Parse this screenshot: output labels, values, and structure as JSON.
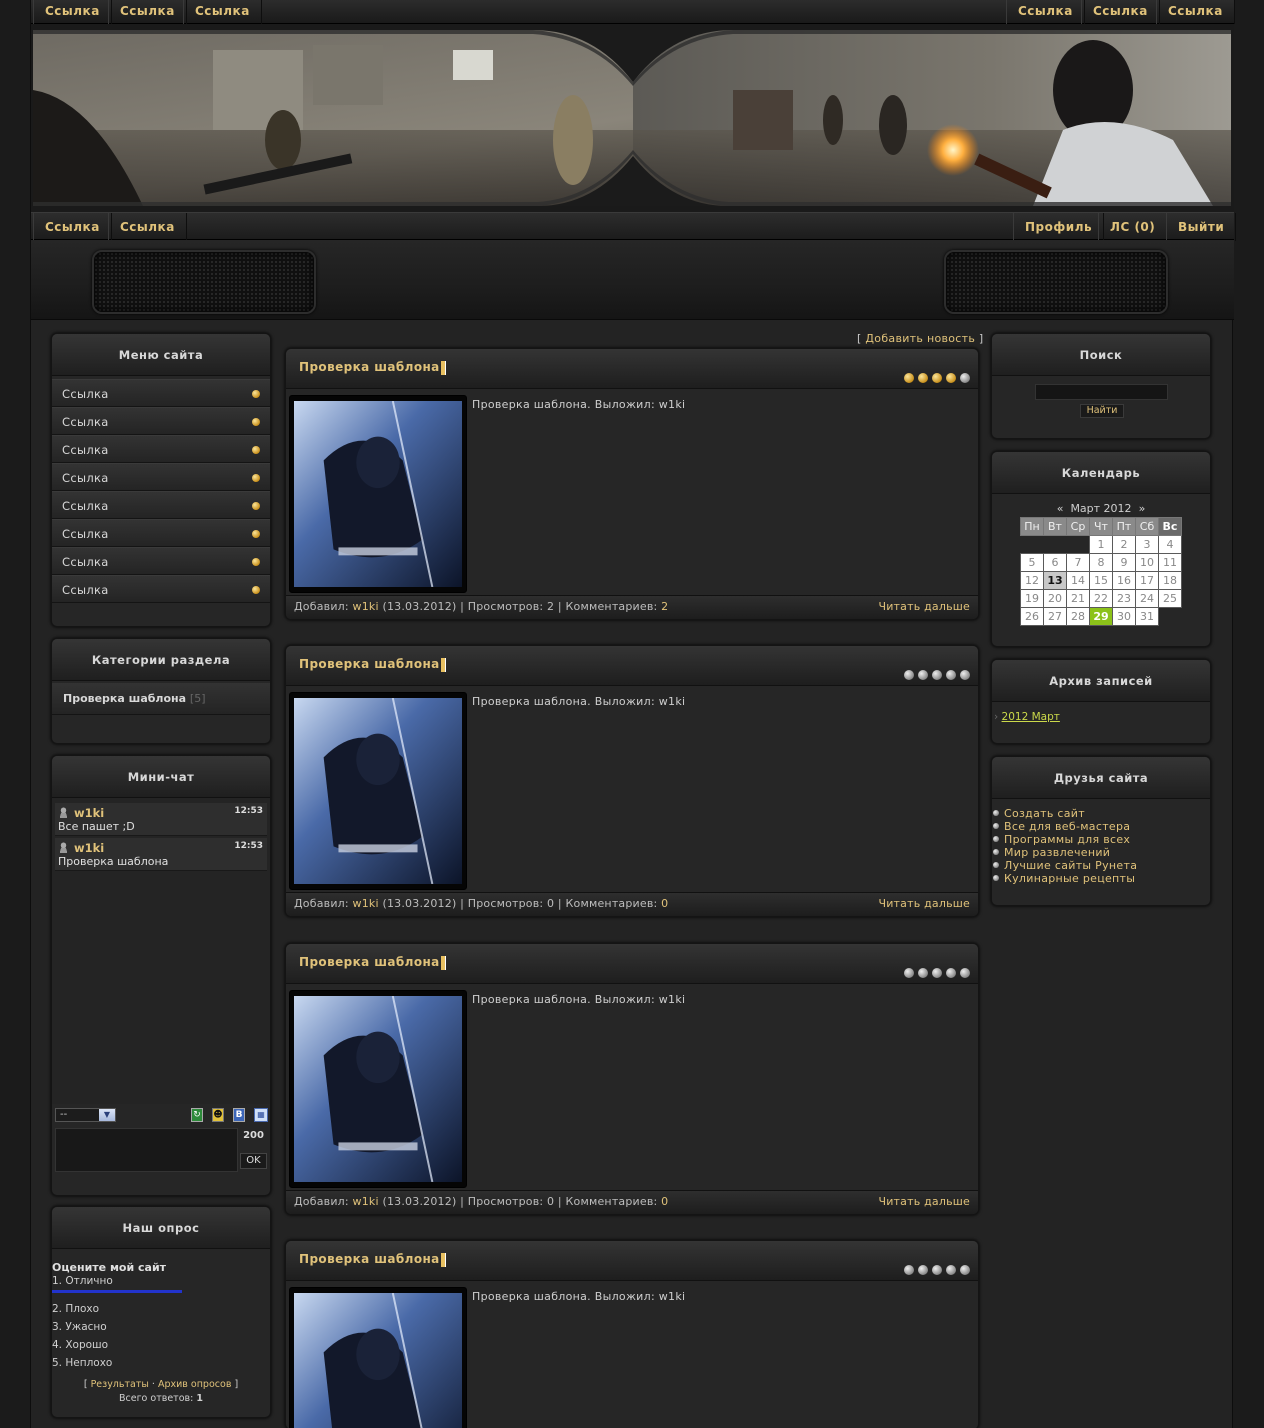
{
  "top_nav": {
    "left": [
      "Ссылка",
      "Ссылка",
      "Ссылка"
    ],
    "right": [
      "Ссылка",
      "Ссылка",
      "Ссылка"
    ]
  },
  "sub_nav": {
    "left": [
      "Ссылка",
      "Ссылка"
    ],
    "right": [
      "Профиль",
      "ЛС (0)",
      "Выйти"
    ]
  },
  "site_menu": {
    "title": "Меню сайта",
    "items": [
      "Ссылка",
      "Ссылка",
      "Ссылка",
      "Ссылка",
      "Ссылка",
      "Ссылка",
      "Ссылка",
      "Ссылка"
    ]
  },
  "categories": {
    "title": "Категории раздела",
    "items": [
      {
        "label": "Проверка шаблона",
        "count": "[5]"
      }
    ]
  },
  "mini_chat": {
    "title": "Мини-чат",
    "messages": [
      {
        "user": "w1ki",
        "time": "12:53",
        "text": "Все пашет ;D"
      },
      {
        "user": "w1ki",
        "time": "12:53",
        "text": "Проверка шаблона"
      }
    ],
    "select_value": "--",
    "counter": "200",
    "ok_label": "OK"
  },
  "poll": {
    "title": "Наш опрос",
    "question": "Оцените мой сайт",
    "options": [
      "1. Отлично",
      "2. Плохо",
      "3. Ужасно",
      "4. Хорошо",
      "5. Неплохо"
    ],
    "results_label": "Результаты",
    "sep": "·",
    "archive_label": "Архив опросов",
    "total_label": "Всего ответов:",
    "total_value": "1"
  },
  "add_news": "Добавить новость",
  "posts": [
    {
      "title": "Проверка шаблона",
      "text": "Проверка шаблона. Выложил: w1ki",
      "author": "w1ki",
      "date": "(13.03.2012)",
      "views": "2",
      "comments": "2",
      "rating": 4
    },
    {
      "title": "Проверка шаблона",
      "text": "Проверка шаблона. Выложил: w1ki",
      "author": "w1ki",
      "date": "(13.03.2012)",
      "views": "0",
      "comments": "0",
      "rating": 0
    },
    {
      "title": "Проверка шаблона",
      "text": "Проверка шаблона. Выложил: w1ki",
      "author": "w1ki",
      "date": "(13.03.2012)",
      "views": "0",
      "comments": "0",
      "rating": 0
    },
    {
      "title": "Проверка шаблона",
      "text": "Проверка шаблона. Выложил: w1ki",
      "author": "",
      "date": "",
      "views": "",
      "comments": "",
      "rating": 0
    }
  ],
  "post_labels": {
    "added": "Добавил:",
    "views": "| Просмотров:",
    "comments": "| Комментариев:",
    "read_more": "Читать дальше"
  },
  "search": {
    "title": "Поиск",
    "button": "Найти"
  },
  "calendar": {
    "title": "Календарь",
    "month": "Март 2012",
    "prev": "«",
    "next": "»",
    "weekdays": [
      "Пн",
      "Вт",
      "Ср",
      "Чт",
      "Пт",
      "Сб",
      "Вс"
    ],
    "weeks": [
      [
        "",
        "",
        "",
        "1",
        "2",
        "3",
        "4"
      ],
      [
        "5",
        "6",
        "7",
        "8",
        "9",
        "10",
        "11"
      ],
      [
        "12",
        "13",
        "14",
        "15",
        "16",
        "17",
        "18"
      ],
      [
        "19",
        "20",
        "21",
        "22",
        "23",
        "24",
        "25"
      ],
      [
        "26",
        "27",
        "28",
        "29",
        "30",
        "31",
        ""
      ]
    ],
    "bold_day": "13",
    "highlight_day": "29"
  },
  "archive": {
    "title": "Архив записей",
    "items": [
      "2012 Март"
    ]
  },
  "friends": {
    "title": "Друзья сайта",
    "items": [
      "Создать сайт",
      "Все для веб-мастера",
      "Программы для всех",
      "Мир развлечений",
      "Лучшие сайты Рунета",
      "Кулинарные рецепты"
    ]
  },
  "colors": {
    "accent": "#e0c27a",
    "calendar_highlight": "#8cc21a",
    "poll_bar": "#2233cc",
    "archive_link": "#cbd94a"
  },
  "icons": [
    "refresh-icon",
    "smiley-icon",
    "bbcode-icon",
    "chat-rules-icon",
    "user-icon"
  ]
}
